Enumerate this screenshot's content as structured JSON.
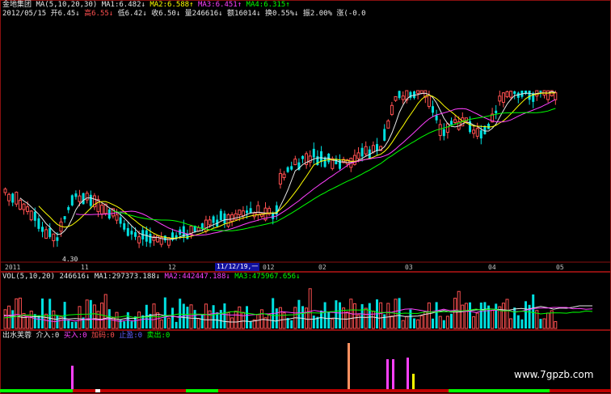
{
  "header": {
    "stock_name": "金地集团",
    "ma_label": "MA(5,10,20,30)",
    "ma1": "MA1:6.482↓",
    "ma2": "MA2:6.588↑",
    "ma3": "MA3:6.451↑",
    "ma4": "MA4:6.315↑"
  },
  "quote": {
    "date": "2012/05/15",
    "open": "开6.45↓",
    "high": "高6.55↓",
    "low": "低6.42↓",
    "close": "收6.50↓",
    "volume": "量246616↓",
    "amount": "额16014↓",
    "turnover": "换0.55%↓",
    "amplitude": "振2.00%",
    "change": "涨(-0.0"
  },
  "price_annotation": "4.30",
  "x_axis": {
    "labels": [
      "2011",
      "11",
      "12",
      "02",
      "03",
      "04",
      "05"
    ],
    "selected_date": "11/12/19,一",
    "selected_suffix": "012"
  },
  "volume_header": {
    "label": "VOL(5,10,20)",
    "value": "246616↓",
    "ma1": "MA1:297373.188↓",
    "ma2": "MA2:442447.188↓",
    "ma3": "MA3:475967.656↓"
  },
  "indicator_header": {
    "name": "出水芙蓉",
    "entry": "介入:0",
    "buy": "买入:0",
    "add": "加码:0",
    "stop": "止盈:0",
    "sell": "卖出:0"
  },
  "watermark": "www.7gpzb.com",
  "colors": {
    "up": "#ff5050",
    "down": "#00e0e0",
    "ma1": "#e8e8e8",
    "ma2": "#ffff00",
    "ma3": "#ff40ff",
    "ma4": "#00ff00",
    "border": "#8a1010"
  }
}
